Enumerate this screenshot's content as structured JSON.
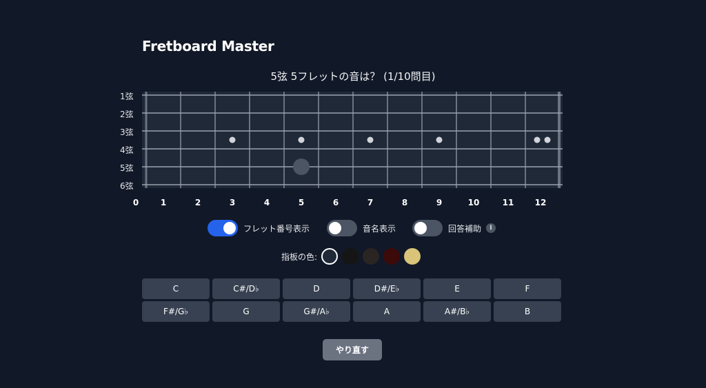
{
  "app": {
    "title": "Fretboard Master"
  },
  "question": {
    "text": "5弦 5フレットの音は？ (1/10問目)"
  },
  "fretboard": {
    "string_labels": [
      "1弦",
      "2弦",
      "3弦",
      "4弦",
      "5弦",
      "6弦"
    ],
    "fret_numbers": [
      "0",
      "1",
      "2",
      "3",
      "4",
      "5",
      "6",
      "7",
      "8",
      "9",
      "10",
      "11",
      "12"
    ],
    "inlay_frets": [
      3,
      5,
      7,
      9
    ],
    "double_inlay_fret": 12,
    "target": {
      "string": 5,
      "fret": 5
    },
    "colors": {
      "board": "#1f2937",
      "string": "#9ca3af",
      "fret": "#6b7280",
      "inlay": "#d1d5db",
      "target": "#4b5563"
    }
  },
  "toggles": [
    {
      "label": "フレット番号表示",
      "on": true
    },
    {
      "label": "音名表示",
      "on": false
    },
    {
      "label": "回答補助",
      "on": false,
      "info_icon": "i"
    }
  ],
  "board_color": {
    "label": "指板の色:",
    "options": [
      {
        "name": "dark-slate",
        "color": "#1f2937",
        "selected": true
      },
      {
        "name": "black",
        "color": "#151515",
        "selected": false
      },
      {
        "name": "dark-brown",
        "color": "#2a2522",
        "selected": false
      },
      {
        "name": "maroon",
        "color": "#3d0a0a",
        "selected": false
      },
      {
        "name": "maple",
        "color": "#d9c47a",
        "selected": false
      }
    ]
  },
  "note_buttons": [
    "C",
    "C#/D♭",
    "D",
    "D#/E♭",
    "E",
    "F",
    "F#/G♭",
    "G",
    "G#/A♭",
    "A",
    "A#/B♭",
    "B"
  ],
  "actions": {
    "retry_label": "やり直す"
  }
}
